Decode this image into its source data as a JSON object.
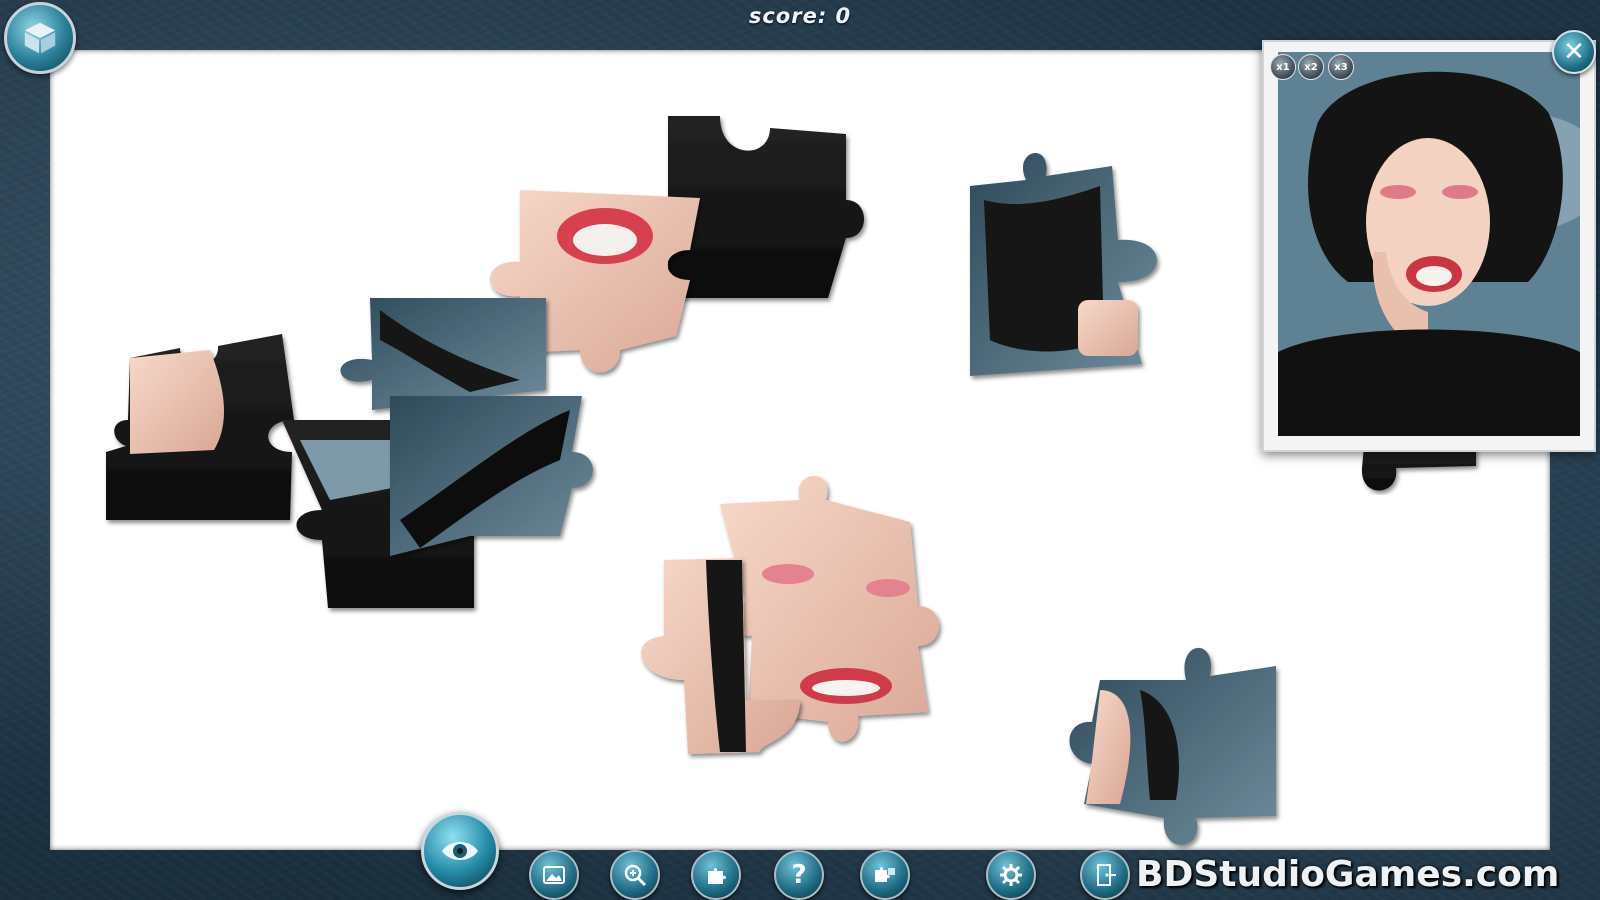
{
  "hud": {
    "score_text": "score: 0"
  },
  "menu": {
    "icon": "puzzle-box-icon"
  },
  "preview": {
    "zoom_options": [
      "x1",
      "x2",
      "x3"
    ],
    "close_label": "✕"
  },
  "toolbar": {
    "tools": [
      {
        "name": "show-image",
        "icon": "image-icon"
      },
      {
        "name": "zoom",
        "icon": "zoom-icon"
      },
      {
        "name": "edge-pieces",
        "icon": "edge-piece-icon"
      },
      {
        "name": "hint",
        "icon": "question-icon",
        "label": "?"
      },
      {
        "name": "sort-pieces",
        "icon": "pieces-icon"
      },
      {
        "name": "settings",
        "icon": "gear-icon"
      },
      {
        "name": "exit",
        "icon": "exit-door-icon"
      }
    ],
    "preview_toggle": {
      "icon": "eye-icon"
    }
  },
  "watermark": "BDStudioGames.com",
  "colors": {
    "board": "#ffffff",
    "frame": "#1d3344",
    "accent": "#2389a6",
    "skin": "#f1c8b5",
    "hair": "#141414",
    "sky": "#4d6d80",
    "lips": "#d8404f"
  }
}
